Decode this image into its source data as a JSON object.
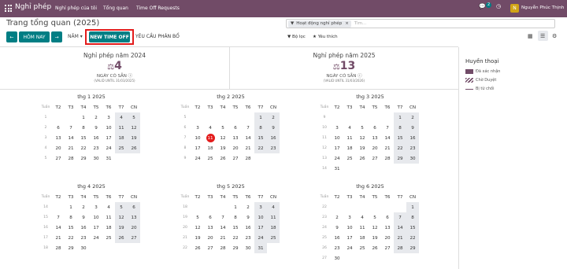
{
  "topbar": {
    "app_name": "Nghỉ phép",
    "nav": [
      "Nghỉ phép của tôi",
      "Tổng quan",
      "Time Off Requests"
    ],
    "chat_badge": "2",
    "avatar": "N",
    "user": "Nguyễn Phúc Thịnh"
  },
  "page": {
    "title": "Trang tổng quan (2025)"
  },
  "search": {
    "facet": "Hoạt động nghỉ phép",
    "placeholder": "Tìm..."
  },
  "toolbar": {
    "today": "HÔM NAY",
    "scale": "NĂM",
    "new_time_off": "NEW TIME OFF",
    "allocation": "YÊU CẦU PHÂN BỔ",
    "filters": "Bộ lọc",
    "favorites": "Yêu thích"
  },
  "summary": [
    {
      "title": "Nghỉ phép năm 2024",
      "days": "4",
      "label": "NGÀY CÓ SẴN",
      "valid": "(VALID UNTIL 31/03/2025)"
    },
    {
      "title": "Nghỉ phép năm 2025",
      "days": "13",
      "label": "NGÀY CÓ SẴN",
      "valid": "(VALID UNTIL 31/03/2026)"
    }
  ],
  "weekday_headers": [
    "Tuần",
    "T2",
    "T3",
    "T4",
    "T5",
    "T6",
    "T7",
    "CN"
  ],
  "today": {
    "month": 1,
    "day": 11
  },
  "months": [
    {
      "title": "thg 1 2025",
      "weeks": [
        "1",
        "2",
        "3",
        "4",
        "5"
      ],
      "days": [
        [
          "",
          "",
          "1",
          "2",
          "3",
          "4",
          "5"
        ],
        [
          "6",
          "7",
          "8",
          "9",
          "10",
          "11",
          "12"
        ],
        [
          "13",
          "14",
          "15",
          "16",
          "17",
          "18",
          "19"
        ],
        [
          "20",
          "21",
          "22",
          "23",
          "24",
          "25",
          "26"
        ],
        [
          "27",
          "28",
          "29",
          "30",
          "31",
          "",
          ""
        ]
      ]
    },
    {
      "title": "thg 2 2025",
      "weeks": [
        "5",
        "6",
        "7",
        "8",
        "9"
      ],
      "days": [
        [
          "",
          "",
          "",
          "",
          "",
          "1",
          "2"
        ],
        [
          "3",
          "4",
          "5",
          "6",
          "7",
          "8",
          "9"
        ],
        [
          "10",
          "11",
          "12",
          "13",
          "14",
          "15",
          "16"
        ],
        [
          "17",
          "18",
          "19",
          "20",
          "21",
          "22",
          "23"
        ],
        [
          "24",
          "25",
          "26",
          "27",
          "28",
          "",
          ""
        ]
      ]
    },
    {
      "title": "thg 3 2025",
      "weeks": [
        "9",
        "10",
        "11",
        "12",
        "13",
        "14"
      ],
      "days": [
        [
          "",
          "",
          "",
          "",
          "",
          "1",
          "2"
        ],
        [
          "3",
          "4",
          "5",
          "6",
          "7",
          "8",
          "9"
        ],
        [
          "10",
          "11",
          "12",
          "13",
          "14",
          "15",
          "16"
        ],
        [
          "17",
          "18",
          "19",
          "20",
          "21",
          "22",
          "23"
        ],
        [
          "24",
          "25",
          "26",
          "27",
          "28",
          "29",
          "30"
        ],
        [
          "31",
          "",
          "",
          "",
          "",
          "",
          ""
        ]
      ]
    },
    {
      "title": "thg 4 2025",
      "weeks": [
        "14",
        "15",
        "16",
        "17",
        "18"
      ],
      "days": [
        [
          "",
          "1",
          "2",
          "3",
          "4",
          "5",
          "6"
        ],
        [
          "7",
          "8",
          "9",
          "10",
          "11",
          "12",
          "13"
        ],
        [
          "14",
          "15",
          "16",
          "17",
          "18",
          "19",
          "20"
        ],
        [
          "21",
          "22",
          "23",
          "24",
          "25",
          "26",
          "27"
        ],
        [
          "28",
          "29",
          "30",
          "",
          "",
          "",
          ""
        ]
      ]
    },
    {
      "title": "thg 5 2025",
      "weeks": [
        "18",
        "19",
        "20",
        "21",
        "22"
      ],
      "days": [
        [
          "",
          "",
          "",
          "1",
          "2",
          "3",
          "4"
        ],
        [
          "5",
          "6",
          "7",
          "8",
          "9",
          "10",
          "11"
        ],
        [
          "12",
          "13",
          "14",
          "15",
          "16",
          "17",
          "18"
        ],
        [
          "19",
          "20",
          "21",
          "22",
          "23",
          "24",
          "25"
        ],
        [
          "26",
          "27",
          "28",
          "29",
          "30",
          "31",
          ""
        ]
      ]
    },
    {
      "title": "thg 6 2025",
      "weeks": [
        "22",
        "23",
        "24",
        "25",
        "26",
        "27"
      ],
      "days": [
        [
          "",
          "",
          "",
          "",
          "",
          "",
          "1"
        ],
        [
          "2",
          "3",
          "4",
          "5",
          "6",
          "7",
          "8"
        ],
        [
          "9",
          "10",
          "11",
          "12",
          "13",
          "14",
          "15"
        ],
        [
          "16",
          "17",
          "18",
          "19",
          "20",
          "21",
          "22"
        ],
        [
          "23",
          "24",
          "25",
          "26",
          "27",
          "28",
          "29"
        ],
        [
          "30",
          "",
          "",
          "",
          "",
          "",
          ""
        ]
      ]
    }
  ],
  "legend": {
    "title": "Huyền thoại",
    "items": [
      {
        "label": "Đã xác nhận",
        "color": "#714B67",
        "style": "solid"
      },
      {
        "label": "Chờ Duyệt",
        "color": "#714B67",
        "style": "striped"
      },
      {
        "label": "Bị từ chối",
        "color": "#714B67",
        "style": "line"
      }
    ]
  }
}
